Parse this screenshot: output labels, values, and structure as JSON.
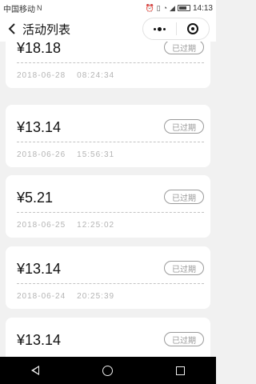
{
  "status_bar": {
    "carrier": "中国移动",
    "icons_left": "N",
    "time": "14:13",
    "battery_label": "58"
  },
  "navbar": {
    "back_icon": "chevron-left-icon",
    "title": "活动列表",
    "more_icon": "more-dots-icon",
    "close_icon": "target-circle-icon"
  },
  "records": [
    {
      "amount": "¥18.18",
      "status": "已过期",
      "date": "2018-06-28",
      "time": "08:24:34"
    },
    {
      "amount": "¥13.14",
      "status": "已过期",
      "date": "2018-06-26",
      "time": "15:56:31"
    },
    {
      "amount": "¥5.21",
      "status": "已过期",
      "date": "2018-06-25",
      "time": "12:25:02"
    },
    {
      "amount": "¥13.14",
      "status": "已过期",
      "date": "2018-06-24",
      "time": "20:25:39"
    },
    {
      "amount": "¥13.14",
      "status": "已过期",
      "date": "",
      "time": ""
    }
  ],
  "system_nav": {
    "back_icon": "triangle-back-icon",
    "home_icon": "circle-home-icon",
    "recent_icon": "square-recent-icon"
  }
}
